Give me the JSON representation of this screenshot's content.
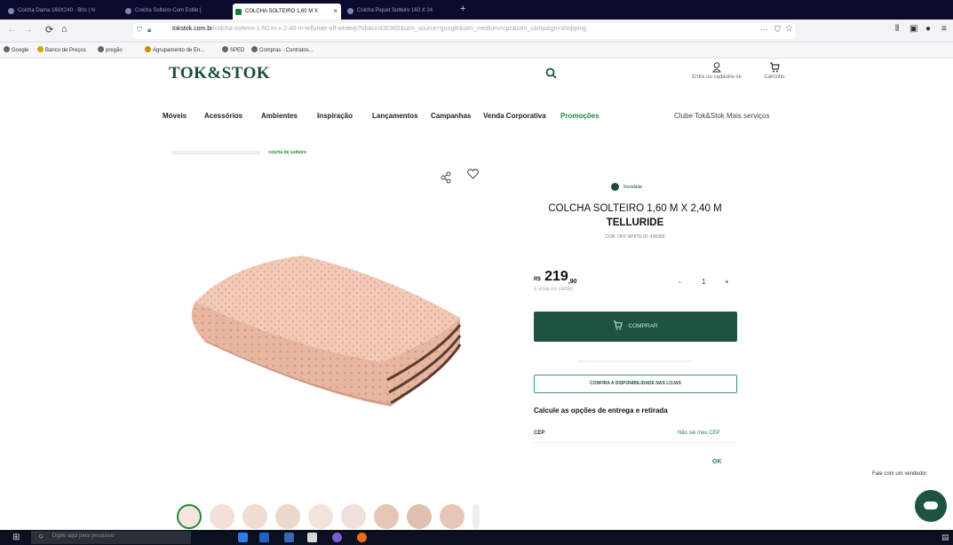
{
  "browser": {
    "tabs": [
      {
        "label": "Colcha Dama 160X240 - Bris | N"
      },
      {
        "label": "Colcha Solteiro Com Estilo |"
      },
      {
        "label": "COLCHA SOLTEIRO 1,60 M X",
        "active": true
      },
      {
        "label": "Colcha Piquet Solteiro 160 X 24"
      }
    ],
    "url_domain": "tokstok.com.br",
    "url_rest": "/colcha-solteiro-1-60-m-x-2-40-m-telluride-off-white/p?idsku=430365&utm_source=google&utm_medium=cpc&utm_campaign=shopping",
    "bookmarks": [
      "Google",
      "Banco de Preços",
      "pregão",
      "Agrupamento de En...",
      "SPED",
      "Compras - Contratos..."
    ]
  },
  "site": {
    "logo": "TOK&STOK",
    "account_label": "Entre ou cadastre-se",
    "cart_label": "Carrinho",
    "menu": [
      "Móveis",
      "Acessórios",
      "Ambientes",
      "Inspiração",
      "Lançamentos",
      "Campanhas",
      "Venda Corporativa",
      "Promoções"
    ],
    "club": "Clube Tok&Stok   Mais serviços",
    "breadcrumb_current": "colcha de solteiro"
  },
  "product": {
    "badge": "Novidade",
    "title_line1": "COLCHA SOLTEIRO 1,60 M X 2,40 M",
    "title_line2": "TELLURIDE",
    "meta": "COR: OFF WHITE    ID: 430365",
    "price_currency": "R$",
    "price_int": "219",
    "price_cents": ",90",
    "installments": "à vista ou cartão",
    "qty_minus": "-",
    "qty_value": "1",
    "qty_plus": "+",
    "buy_label": "COMPRAR",
    "availability_label": "CONFIRA A DISPONIBILIDADE NAS LOJAS",
    "delivery_title": "Calcule as opções de entrega e retirada",
    "cep_label": "CEP",
    "cep_help": "Não sei meu CEP",
    "ok_label": "OK"
  },
  "chat": {
    "label": "Fale com um vendedor"
  },
  "taskbar": {
    "search_placeholder": "Digite aqui para pesquisar"
  },
  "colors": {
    "brand_green": "#1d5440",
    "accent_green": "#1f8a3d"
  }
}
